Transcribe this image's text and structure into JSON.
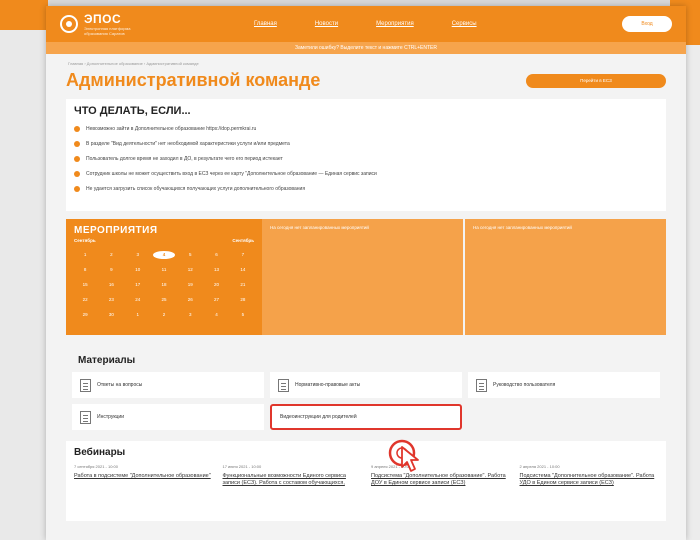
{
  "brand": {
    "name": "ЭПОС",
    "tagline": "Электронная платформа образования Саратов"
  },
  "nav": {
    "items": [
      "Главная",
      "Новости",
      "Мероприятия",
      "Сервисы"
    ],
    "login_label": "Вход"
  },
  "notice": "Заметили ошибку? Выделите текст и нажмите CTRL+ENTER",
  "breadcrumb": "Главная › Дополнительное образование › Административной команде",
  "page_title": "Административной команде",
  "title_button": "Перейти в ЕСЗ",
  "faq": {
    "title": "ЧТО ДЕЛАТЬ, ЕСЛИ...",
    "items": [
      "Невозможно зайти в Дополнительное образование https://dop.permkrai.ru",
      "В разделе \"Вид деятельности\" нет необходимой характеристики услуги и/или предмета",
      "Пользователь долгое время не заходил в ДО, в результате чего его период истекает",
      "Сотрудник школы не может осуществить вход в ЕСЗ через ее карту \"Дополнительное образование — Единая сервис записи",
      "Не удается загрузить список обучающихся получающих услуги дополнительного образования"
    ]
  },
  "events": {
    "title": "МЕРОПРИЯТИЯ",
    "month_left": "Сентябрь",
    "month_right": "Сентябрь",
    "days": [
      "1",
      "2",
      "3",
      "4",
      "5",
      "6",
      "7",
      "8",
      "9",
      "10",
      "11",
      "12",
      "13",
      "14",
      "15",
      "16",
      "17",
      "18",
      "19",
      "20",
      "21",
      "22",
      "23",
      "24",
      "25",
      "26",
      "27",
      "28",
      "29",
      "30",
      "1",
      "2",
      "3",
      "4",
      "5"
    ],
    "selected_day": "4",
    "empty_1": "На сегодня нет запланированных мероприятий",
    "empty_2": "На сегодня нет запланированных мероприятий"
  },
  "materials": {
    "title": "Материалы",
    "items": [
      "Ответы на вопросы",
      "Нормативно-правовые акты",
      "Руководство пользователя",
      "Инструкции",
      "Видеоинструкции для родителей"
    ]
  },
  "webinars": {
    "title": "Вебинары",
    "items": [
      {
        "date": "7 сентября 2021 - 10:00",
        "title": "Работа в подсистеме \"Дополнительное образование\""
      },
      {
        "date": "17 июня 2021 - 10:00",
        "title": "Функциональные возможности Единого сервиса записи (ЕСЗ). Работа с составом обучающихся,"
      },
      {
        "date": "9 апреля 2021 - 10:00",
        "title": "Подсистема \"Дополнительное образование\". Работа ДОУ в Едином сервисе записи (ЕСЗ)"
      },
      {
        "date": "2 апреля 2021 - 10:00",
        "title": "Подсистема \"Дополнительное образование\". Работа УДО в Едином сервисе записи (ЕСЗ)"
      }
    ]
  },
  "colors": {
    "accent": "#f08a1c",
    "highlight_border": "#e0362c"
  }
}
